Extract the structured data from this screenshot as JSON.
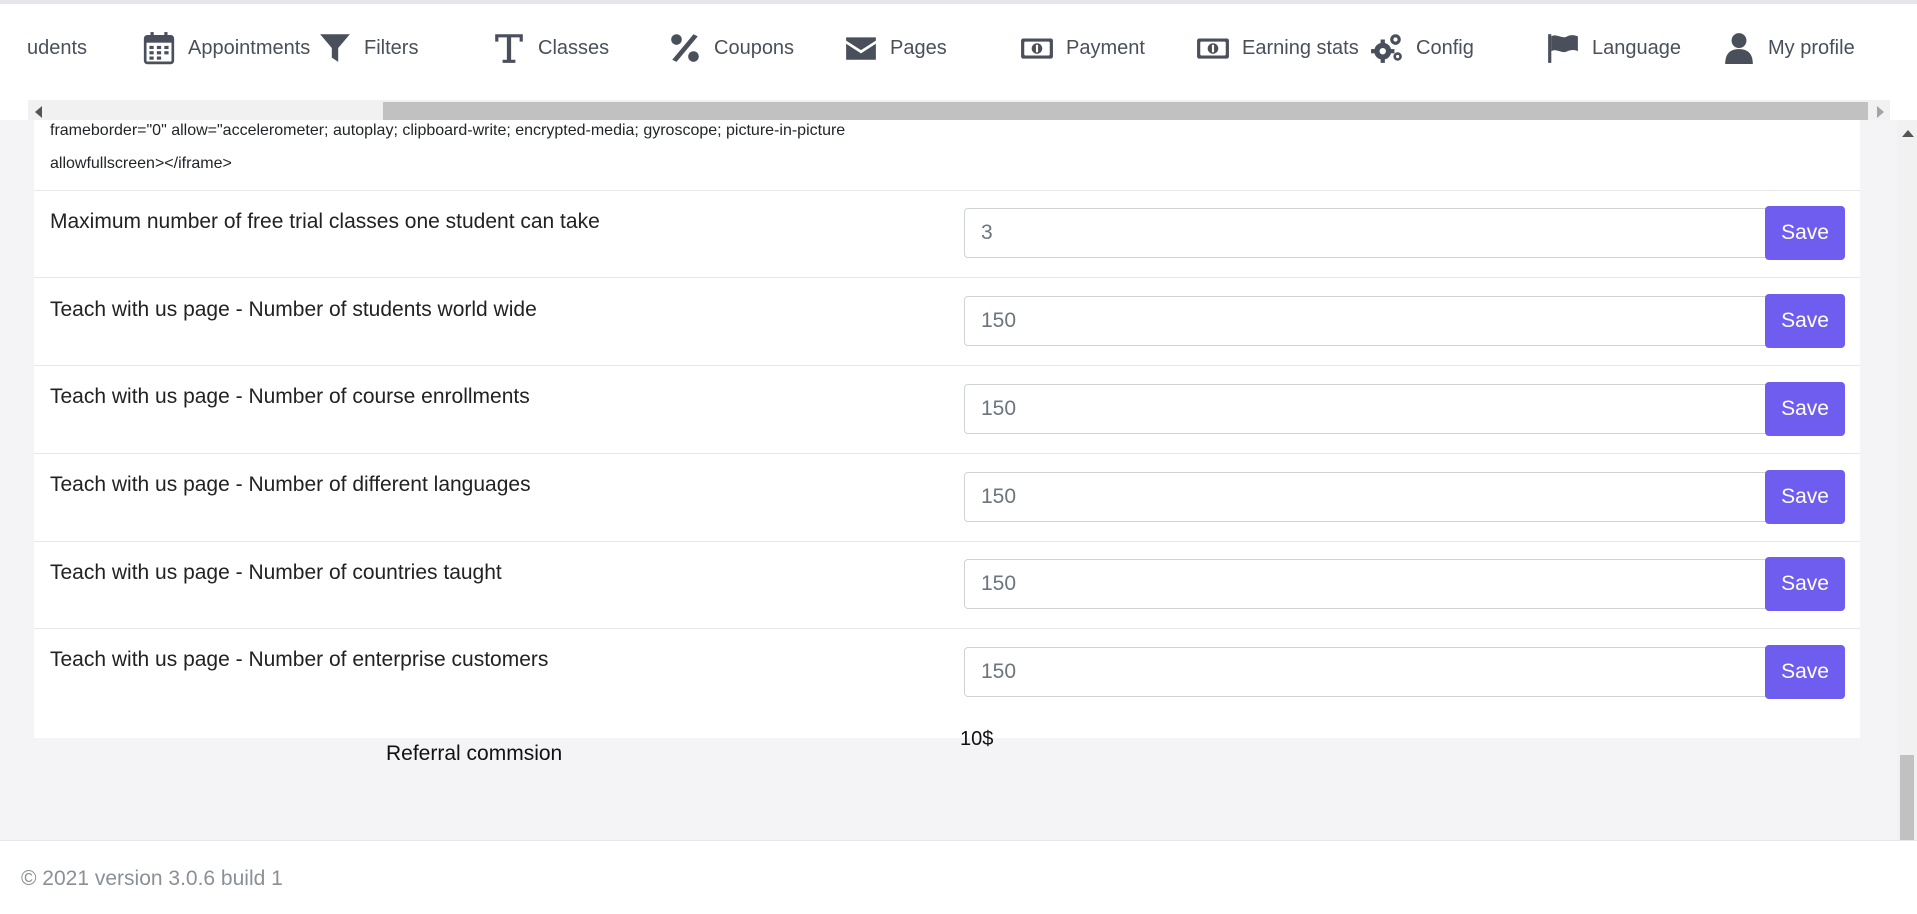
{
  "nav": {
    "items": [
      {
        "label": "udents",
        "icon": "none"
      },
      {
        "label": "Appointments",
        "icon": "calendar-icon"
      },
      {
        "label": "Filters",
        "icon": "filter-icon"
      },
      {
        "label": "Classes",
        "icon": "text-icon"
      },
      {
        "label": "Coupons",
        "icon": "percent-icon"
      },
      {
        "label": "Pages",
        "icon": "envelope-icon"
      },
      {
        "label": "Payment",
        "icon": "money-icon"
      },
      {
        "label": "Earning stats",
        "icon": "money-icon"
      },
      {
        "label": "Config",
        "icon": "gears-icon"
      },
      {
        "label": "Language",
        "icon": "flag-icon"
      },
      {
        "label": "My profile",
        "icon": "user-icon"
      }
    ]
  },
  "snippet": {
    "line1": "frameborder=\"0\" allow=\"accelerometer; autoplay; clipboard-write; encrypted-media; gyroscope; picture-in-picture",
    "line2": "allowfullscreen></iframe>"
  },
  "settings": [
    {
      "label": "Maximum number of free trial classes one student can take",
      "value": "3",
      "button": "Save"
    },
    {
      "label": "Teach with us page - Number of students world wide",
      "value": "150",
      "button": "Save"
    },
    {
      "label": "Teach with us page - Number of course enrollments",
      "value": "150",
      "button": "Save"
    },
    {
      "label": "Teach with us page - Number of different languages",
      "value": "150",
      "button": "Save"
    },
    {
      "label": "Teach with us page - Number of countries taught",
      "value": "150",
      "button": "Save"
    },
    {
      "label": "Teach with us page - Number of enterprise customers",
      "value": "150",
      "button": "Save"
    }
  ],
  "referral": {
    "label": "Referral commsion",
    "value": "10$"
  },
  "footer": {
    "text": "© 2021 version 3.0.6 build 1"
  },
  "colors": {
    "accent": "#6f5df0",
    "nav_text": "#4a4f5c",
    "background": "#f4f4f6"
  }
}
